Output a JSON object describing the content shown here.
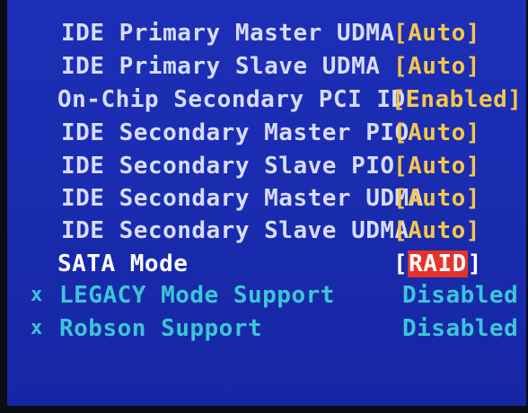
{
  "rows": [
    {
      "label": "IDE Primary Master UDMA",
      "value": "[Auto]"
    },
    {
      "label": "IDE Primary Slave  UDMA",
      "value": "[Auto]"
    },
    {
      "label": "On-Chip Secondary PCI IDE",
      "value": "[Enabled]"
    },
    {
      "label": "IDE Secondary Master PIO",
      "value": "[Auto]"
    },
    {
      "label": "IDE Secondary Slave  PIO",
      "value": "[Auto]"
    },
    {
      "label": "IDE Secondary Master UDMA",
      "value": "[Auto]"
    },
    {
      "label": "IDE Secondary Slave  UDMA",
      "value": "[Auto]"
    }
  ],
  "sata": {
    "label": "SATA Mode",
    "open": "[",
    "selected": "RAID",
    "close": "]"
  },
  "disabled": [
    {
      "marker": "x",
      "label": "LEGACY Mode Support",
      "value": "Disabled"
    },
    {
      "marker": "x",
      "label": "Robson Support",
      "value": "Disabled"
    }
  ],
  "colors": {
    "background": "#1a2cb0",
    "label": "#d7dcff",
    "value": "#f5c64a",
    "disabled": "#3cc6d6",
    "selected_bg": "#e5322a"
  }
}
